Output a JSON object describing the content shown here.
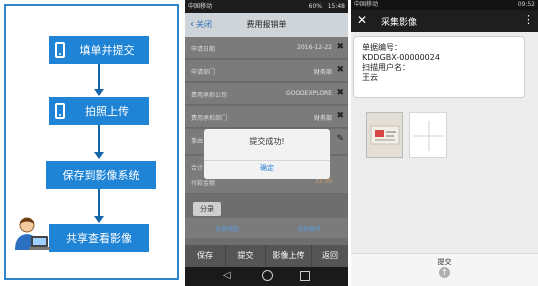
{
  "flow": {
    "steps": [
      "填单并提交",
      "拍照上传",
      "保存到影像系统",
      "共享查看影像"
    ],
    "step_icons": [
      "phone-icon",
      "phone-icon",
      "none",
      "user-computer-icon"
    ]
  },
  "form_app": {
    "status_bar": {
      "carrier": "中国移动",
      "battery": "60%",
      "time": "15:48"
    },
    "header": {
      "back": "关闭",
      "title": "费用报销单"
    },
    "rows": [
      {
        "label": "申请日期",
        "value": "2016-12-22"
      },
      {
        "label": "申请部门",
        "value": "财务部"
      },
      {
        "label": "费用承担公司",
        "value": "GOODEXPLORE"
      },
      {
        "label": "费用承担部门",
        "value": "财务部"
      },
      {
        "label": "事由",
        "value": ""
      },
      {
        "label": "合计",
        "value": ""
      },
      {
        "label": "付款金额",
        "value": "33.00"
      }
    ],
    "dialog": {
      "message": "提交成功!",
      "ok": "确定"
    },
    "tab": "分录",
    "links": {
      "collapse": "全部收起",
      "expand": "全部展开"
    },
    "bottom_buttons": [
      "保存",
      "提交",
      "影像上传",
      "返回"
    ]
  },
  "capture_app": {
    "status_bar": {
      "carrier": "中国移动",
      "time": "09:52"
    },
    "header": {
      "title": "采集影像"
    },
    "info": {
      "doc_no_label": "单据编号：",
      "doc_no": "KDDGBX-00000024",
      "scanner_label": "扫描用户名：",
      "scanner": "王云"
    },
    "submit_label": "提交"
  }
}
